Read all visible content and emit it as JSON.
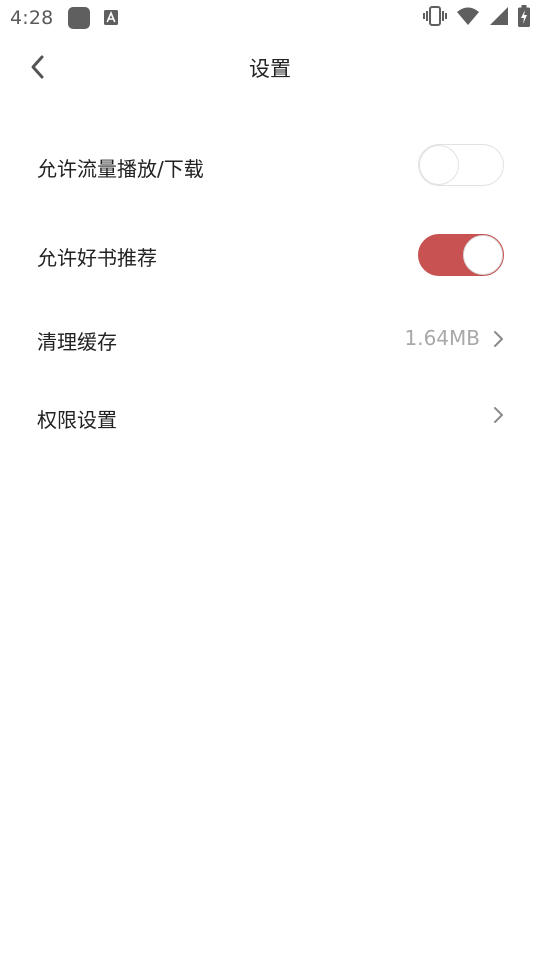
{
  "status_bar": {
    "time": "4:28",
    "icons": [
      "app-notification-icon",
      "a-keyboard-icon",
      "vibrate-icon",
      "wifi-icon",
      "signal-icon",
      "battery-charging-icon"
    ]
  },
  "header": {
    "title": "设置",
    "back_icon": "chevron-left-icon"
  },
  "settings": {
    "items": [
      {
        "label": "允许流量播放/下载",
        "control": "toggle",
        "checked": false
      },
      {
        "label": "允许好书推荐",
        "control": "toggle",
        "checked": true
      },
      {
        "label": "清理缓存",
        "control": "link",
        "value": "1.64MB"
      },
      {
        "label": "权限设置",
        "control": "link"
      }
    ]
  },
  "colors": {
    "accent": "#c85151",
    "text_primary": "#222222",
    "text_secondary": "#a8a8a8",
    "background": "#ffffff"
  }
}
